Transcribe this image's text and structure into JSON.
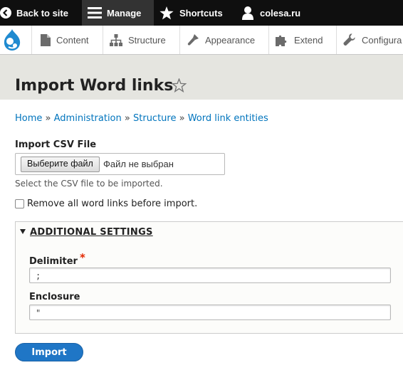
{
  "toolbar": {
    "back_label": "Back to site",
    "manage_label": "Manage",
    "shortcuts_label": "Shortcuts",
    "user_label": "colesa.ru"
  },
  "tray": {
    "items": [
      {
        "label": "Content",
        "icon": "page-icon"
      },
      {
        "label": "Structure",
        "icon": "structure-icon"
      },
      {
        "label": "Appearance",
        "icon": "brush-icon"
      },
      {
        "label": "Extend",
        "icon": "puzzle-icon"
      },
      {
        "label": "Configura",
        "icon": "wrench-icon"
      }
    ]
  },
  "page": {
    "title": "Import Word links"
  },
  "breadcrumb": {
    "items": [
      "Home",
      "Administration",
      "Structure",
      "Word link entities"
    ],
    "separator": "»"
  },
  "form": {
    "file_label": "Import CSV File",
    "file_button": "Выберите файл",
    "file_status": "Файл не выбран",
    "file_description": "Select the CSV file to be imported.",
    "remove_label": "Remove all word links before import.",
    "settings_title": "ADDITIONAL SETTINGS",
    "delimiter_label": "Delimiter",
    "required_mark": "*",
    "delimiter_value": ";",
    "enclosure_label": "Enclosure",
    "enclosure_value": "\"",
    "submit_label": "Import"
  },
  "colors": {
    "toolbar_bg": "#0f0f0f",
    "link": "#0074bd",
    "primary_button": "#1f76c6",
    "required": "#e32700"
  }
}
